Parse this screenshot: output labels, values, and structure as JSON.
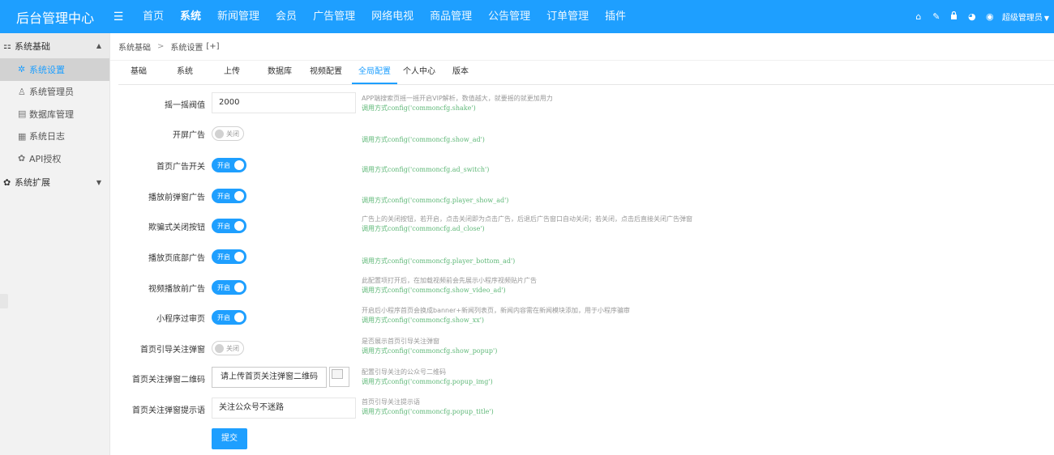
{
  "header": {
    "brand": "后台管理中心",
    "menu_toggle_glyph": "☰",
    "nav": [
      "首页",
      "系统",
      "新闻管理",
      "会员",
      "广告管理",
      "网络电视",
      "商品管理",
      "公告管理",
      "订单管理",
      "插件"
    ],
    "active_nav": "系统",
    "right_icons": [
      {
        "name": "home-icon",
        "glyph": "⌂"
      },
      {
        "name": "brush-icon",
        "glyph": "✎"
      },
      {
        "name": "lock-icon",
        "glyph": "🔒"
      },
      {
        "name": "palette-icon",
        "glyph": "◕"
      },
      {
        "name": "globe-icon",
        "glyph": "◉"
      }
    ],
    "admin_label": "超级管理员",
    "admin_caret": "▼"
  },
  "sidebar": {
    "group1": {
      "label": "系统基础",
      "icon": "grid-icon",
      "glyph": "⚏",
      "arrow": "▲"
    },
    "items": [
      {
        "label": "系统设置",
        "icon": "gear-icon",
        "glyph": "✲",
        "active": true
      },
      {
        "label": "系统管理员",
        "icon": "user-icon",
        "glyph": "♙",
        "active": false
      },
      {
        "label": "数据库管理",
        "icon": "database-icon",
        "glyph": "▤",
        "active": false
      },
      {
        "label": "系统日志",
        "icon": "log-icon",
        "glyph": "▦",
        "active": false
      },
      {
        "label": "API授权",
        "icon": "api-icon",
        "glyph": "✿",
        "active": false
      }
    ],
    "group2": {
      "label": "系统扩展",
      "icon": "gear-icon",
      "glyph": "✿",
      "arrow": "▼"
    }
  },
  "breadcrumb": {
    "items": [
      "系统基础",
      "系统设置"
    ],
    "separator": ">",
    "suffix": "[+]"
  },
  "tabs": {
    "items": [
      "基础",
      "系统",
      "上传",
      "数据库",
      "视频配置",
      "全局配置",
      "个人中心",
      "版本"
    ],
    "active": "全局配置"
  },
  "form": {
    "shake": {
      "label": "摇一摇阀值",
      "value": "2000",
      "help": "APP端搜索页摇一摇开启VIP解析，数值越大，就要摇的就更加用力",
      "code": "调用方式config('commoncfg.shake')"
    },
    "show_ad": {
      "label": "开屏广告",
      "state": "关闭",
      "help": "",
      "code": "调用方式config('commoncfg.show_ad')"
    },
    "ad_switch": {
      "label": "首页广告开关",
      "state": "开启",
      "help": "",
      "code": "调用方式config('commoncfg.ad_switch')"
    },
    "player_show_ad": {
      "label": "播放前弹窗广告",
      "state": "开启",
      "help": "",
      "code": "调用方式config('commoncfg.player_show_ad')"
    },
    "ad_close": {
      "label": "欺骗式关闭按钮",
      "state": "开启",
      "help": "广告上的关闭按钮，若开启，点击关闭即为点击广告，后退后广告窗口自动关闭；若关闭，点击后直接关闭广告弹窗",
      "code": "调用方式config('commoncfg.ad_close')"
    },
    "player_bottom_ad": {
      "label": "播放页底部广告",
      "state": "开启",
      "help": "",
      "code": "调用方式config('commoncfg.player_bottom_ad')"
    },
    "show_video_ad": {
      "label": "视频播放前广告",
      "state": "开启",
      "help": "此配置项打开后，在加载视频前会先展示小程序视频贴片广告",
      "code": "调用方式config('commoncfg.show_video_ad')"
    },
    "show_xx": {
      "label": "小程序过审页",
      "state": "开启",
      "help": "开启后小程序首页会换成banner+新闻列表页，新闻内容需在新闻模块添加，用于小程序骗审",
      "code": "调用方式config('commoncfg.show_xx')"
    },
    "show_popup": {
      "label": "首页引导关注弹窗",
      "state": "关闭",
      "help": "是否展示首页引导关注弹窗",
      "code": "调用方式config('commoncfg.show_popup')"
    },
    "popup_img": {
      "label": "首页关注弹窗二维码",
      "button": "请上传首页关注弹窗二维码",
      "help": "配置引导关注的公众号二维码",
      "code": "调用方式config('commoncfg.popup_img')"
    },
    "popup_title": {
      "label": "首页关注弹窗提示语",
      "value": "关注公众号不迷路",
      "help": "首页引导关注提示语",
      "code": "调用方式config('commoncfg.popup_title')"
    },
    "submit_label": "提交"
  },
  "colors": {
    "primary": "#1e9fff",
    "code": "#5fb878",
    "muted": "#999999"
  }
}
